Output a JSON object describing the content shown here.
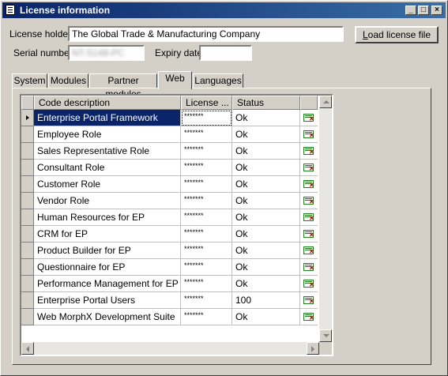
{
  "window": {
    "title": "License information"
  },
  "form": {
    "license_holder_label": "License holder",
    "license_holder_value": "The Global Trade & Manufacturing Company",
    "serial_label": "Serial number",
    "serial_value": "NT-5148-PC",
    "expiry_label": "Expiry date",
    "expiry_value": "",
    "load_button_label": "Load license file"
  },
  "tabs": [
    {
      "label": "System",
      "active": false
    },
    {
      "label": "Modules",
      "active": false
    },
    {
      "label": "Partner modules",
      "active": false
    },
    {
      "label": "Web",
      "active": true
    },
    {
      "label": "Languages",
      "active": false
    }
  ],
  "grid": {
    "columns": [
      "Code description",
      "License ...",
      "Status"
    ],
    "rows": [
      {
        "desc": "Enterprise Portal Framework",
        "key": "*******",
        "status": "Ok",
        "current": true
      },
      {
        "desc": "Employee Role",
        "key": "*******",
        "status": "Ok"
      },
      {
        "desc": "Sales Representative Role",
        "key": "*******",
        "status": "Ok"
      },
      {
        "desc": "Consultant Role",
        "key": "*******",
        "status": "Ok"
      },
      {
        "desc": "Customer Role",
        "key": "*******",
        "status": "Ok"
      },
      {
        "desc": "Vendor Role",
        "key": "*******",
        "status": "Ok"
      },
      {
        "desc": "Human Resources for EP",
        "key": "*******",
        "status": "Ok"
      },
      {
        "desc": "CRM for EP",
        "key": "*******",
        "status": "Ok"
      },
      {
        "desc": "Product Builder for EP",
        "key": "*******",
        "status": "Ok"
      },
      {
        "desc": "Questionnaire for EP",
        "key": "*******",
        "status": "Ok"
      },
      {
        "desc": "Performance Management for EP",
        "key": "*******",
        "status": "Ok"
      },
      {
        "desc": "Enterprise Portal Users",
        "key": "*******",
        "status": "100"
      },
      {
        "desc": "Web MorphX Development Suite",
        "key": "*******",
        "status": "Ok"
      }
    ]
  },
  "colors": {
    "title_bar": "#0a246a",
    "selection": "#0a246a",
    "face": "#d4d0c8"
  },
  "icons": {
    "app": "form-icon",
    "row_action": "license-edit-icon"
  }
}
